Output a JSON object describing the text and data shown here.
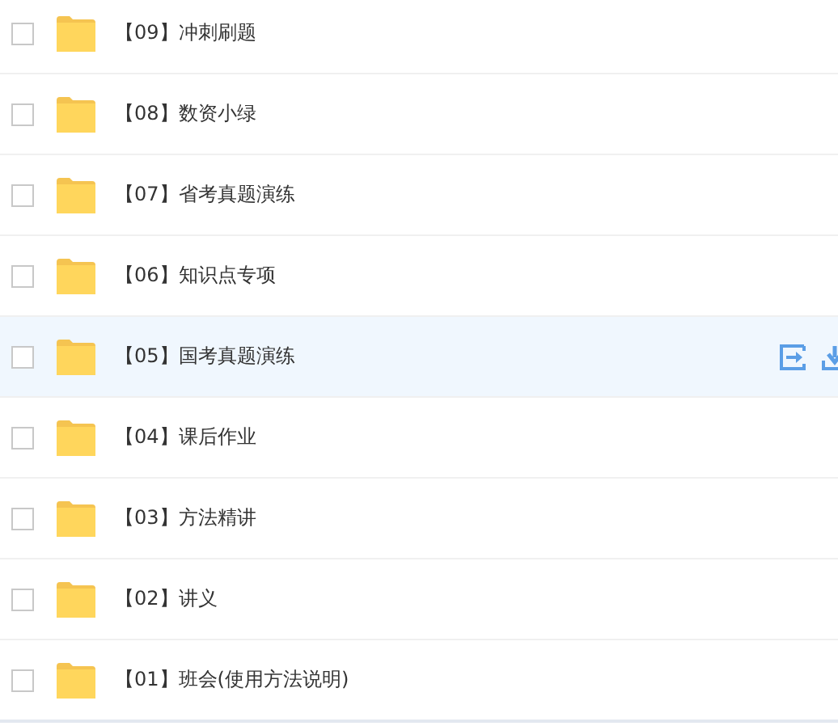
{
  "folders": [
    {
      "name": "【09】冲刺刷题",
      "checked": false,
      "hovered": false
    },
    {
      "name": "【08】数资小绿",
      "checked": false,
      "hovered": false
    },
    {
      "name": "【07】省考真题演练",
      "checked": false,
      "hovered": false
    },
    {
      "name": "【06】知识点专项",
      "checked": false,
      "hovered": false
    },
    {
      "name": "【05】国考真题演练",
      "checked": false,
      "hovered": true
    },
    {
      "name": "【04】课后作业",
      "checked": false,
      "hovered": false
    },
    {
      "name": "【03】方法精讲",
      "checked": false,
      "hovered": false
    },
    {
      "name": "【02】讲义",
      "checked": false,
      "hovered": false
    },
    {
      "name": "【01】班会(使用方法说明)",
      "checked": false,
      "hovered": false
    }
  ]
}
